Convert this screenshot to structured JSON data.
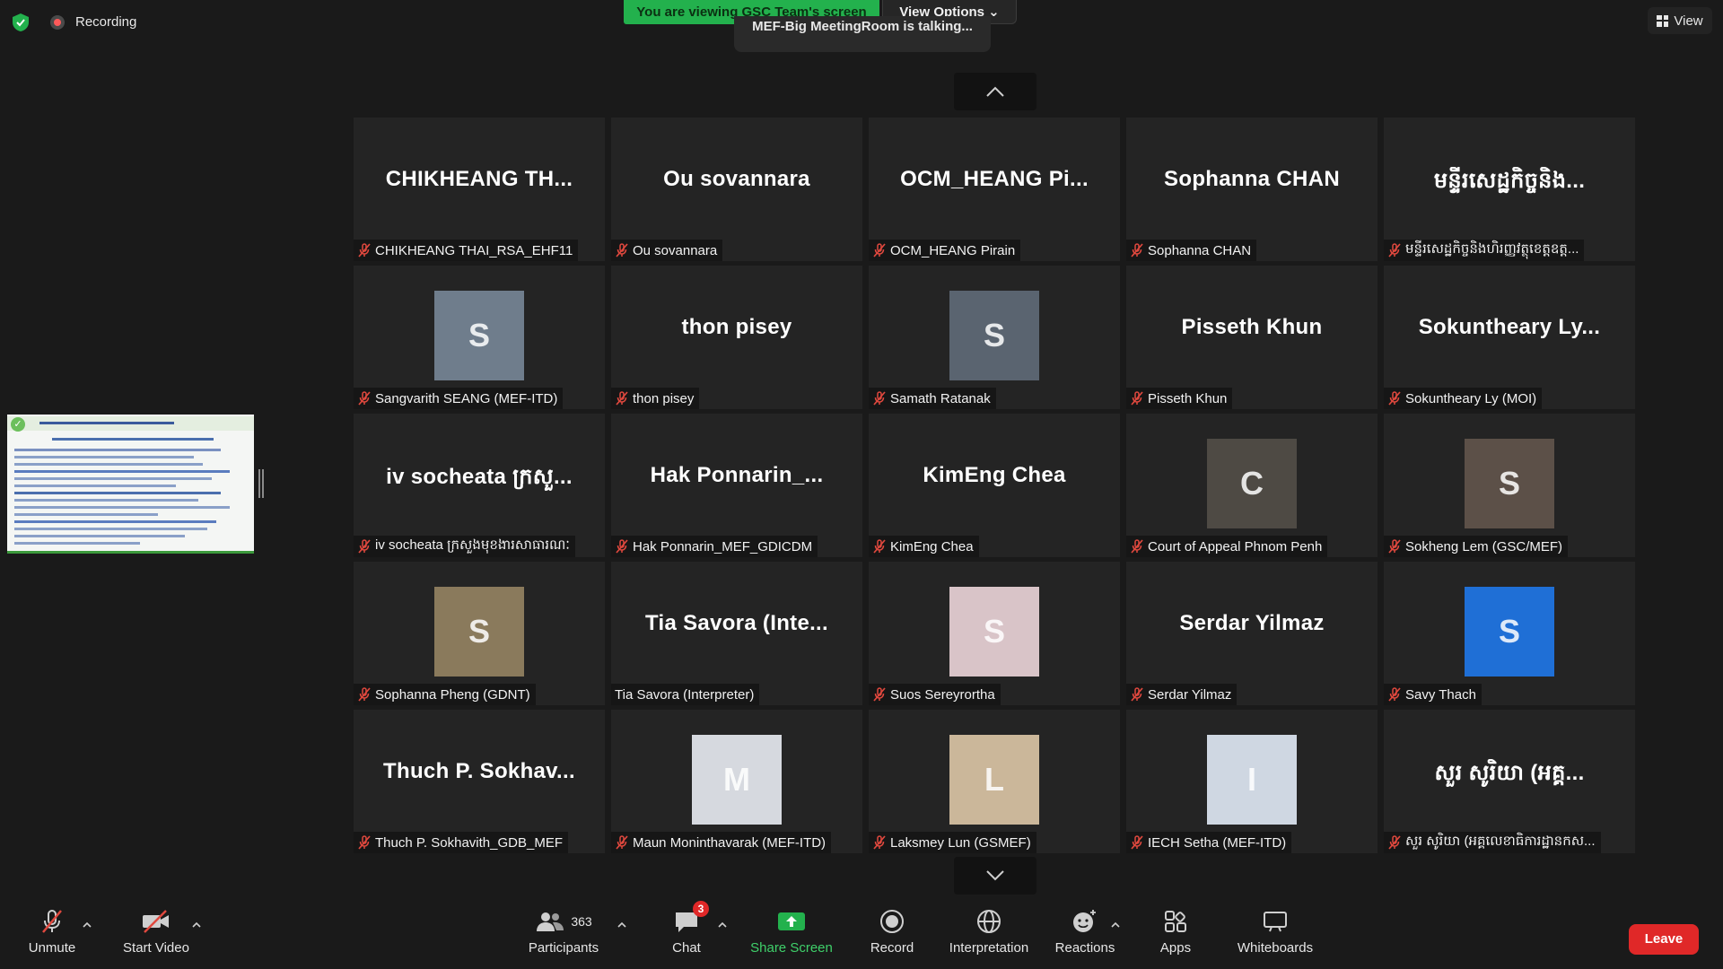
{
  "top": {
    "recording_label": "Recording",
    "viewing_banner": "You are viewing GSC Team's screen",
    "view_options_label": "View Options",
    "talking_text": "MEF-Big MeetingRoom is talking...",
    "view_label": "View"
  },
  "tiles": [
    {
      "big": "CHIKHEANG  TH...",
      "label": "CHIKHEANG THAI_RSA_EHF11",
      "muted": true
    },
    {
      "big": "Ou sovannara",
      "label": "Ou sovannara",
      "muted": true
    },
    {
      "big": "OCM_HEANG  Pi...",
      "label": "OCM_HEANG Pirain",
      "muted": true
    },
    {
      "big": "Sophanna CHAN",
      "label": "Sophanna CHAN",
      "muted": true
    },
    {
      "big": "មន្ទីរសេដ្ឋកិច្ចនិង...",
      "label": "មន្ទីរសេដ្ឋកិច្ចនិងហិរញ្ញវត្ថុខេត្តឧត្ត...",
      "muted": true
    },
    {
      "photo": "S",
      "photo_color": "#6f7d8c",
      "label": "Sangvarith SEANG (MEF-ITD)",
      "muted": true
    },
    {
      "big": "thon pisey",
      "label": "thon pisey",
      "muted": true
    },
    {
      "photo": "S",
      "photo_color": "#5a6470",
      "label": "Samath Ratanak",
      "muted": true
    },
    {
      "big": "Pisseth Khun",
      "label": "Pisseth Khun",
      "muted": true
    },
    {
      "big": "Sokuntheary  Ly...",
      "label": "Sokuntheary Ly (MOI)",
      "muted": true
    },
    {
      "big": "iv  socheata  ក្រសួ...",
      "label": "iv socheata ក្រសួងមុខងារសាធារណៈ",
      "muted": true
    },
    {
      "big": "Hak  Ponnarin_...",
      "label": "Hak Ponnarin_MEF_GDICDM",
      "muted": true
    },
    {
      "big": "KimEng Chea",
      "label": "KimEng Chea",
      "muted": true
    },
    {
      "photo": "C",
      "photo_color": "#4e4a44",
      "label": "Court of Appeal Phnom Penh",
      "muted": true
    },
    {
      "photo": "S",
      "photo_color": "#5c5048",
      "label": "Sokheng Lem (GSC/MEF)",
      "muted": true
    },
    {
      "photo": "S",
      "photo_color": "#8a7a5c",
      "label": "Sophanna Pheng (GDNT)",
      "muted": true
    },
    {
      "big": "Tia  Savora  (Inte...",
      "label": "Tia Savora (Interpreter)",
      "muted": false
    },
    {
      "photo": "S",
      "photo_color": "#d9c4c8",
      "label": "Suos Sereyrortha",
      "muted": true
    },
    {
      "big": "Serdar Yilmaz",
      "label": "Serdar Yilmaz",
      "muted": true
    },
    {
      "photo": "S",
      "photo_color": "#1f6fd6",
      "label": "Savy Thach",
      "muted": true
    },
    {
      "big": "Thuch  P.  Sokhav...",
      "label": "Thuch P. Sokhavith_GDB_MEF",
      "muted": true
    },
    {
      "photo": "M",
      "photo_color": "#d6d9df",
      "label": "Maun Moninthavarak (MEF-ITD)",
      "muted": true
    },
    {
      "photo": "L",
      "photo_color": "#cbb79a",
      "label": "Laksmey Lun (GSMEF)",
      "muted": true
    },
    {
      "photo": "I",
      "photo_color": "#cfd7e2",
      "label": "IECH Setha (MEF-ITD)",
      "muted": true
    },
    {
      "big": "សួរ  សូរិយា  (អគ្គ...",
      "label": "សួរ សូរិយា (អគ្គលេខាធិការដ្ឋានកស...",
      "muted": true
    }
  ],
  "toolbar": {
    "unmute": "Unmute",
    "start_video": "Start Video",
    "participants": "Participants",
    "participants_count": "363",
    "chat": "Chat",
    "chat_badge": "3",
    "share_screen": "Share Screen",
    "record": "Record",
    "interpretation": "Interpretation",
    "reactions": "Reactions",
    "apps": "Apps",
    "whiteboards": "Whiteboards",
    "leave": "Leave"
  },
  "colors": {
    "share_green": "#23b14d",
    "leave_red": "#e02828",
    "muted_red": "#e0483e"
  }
}
